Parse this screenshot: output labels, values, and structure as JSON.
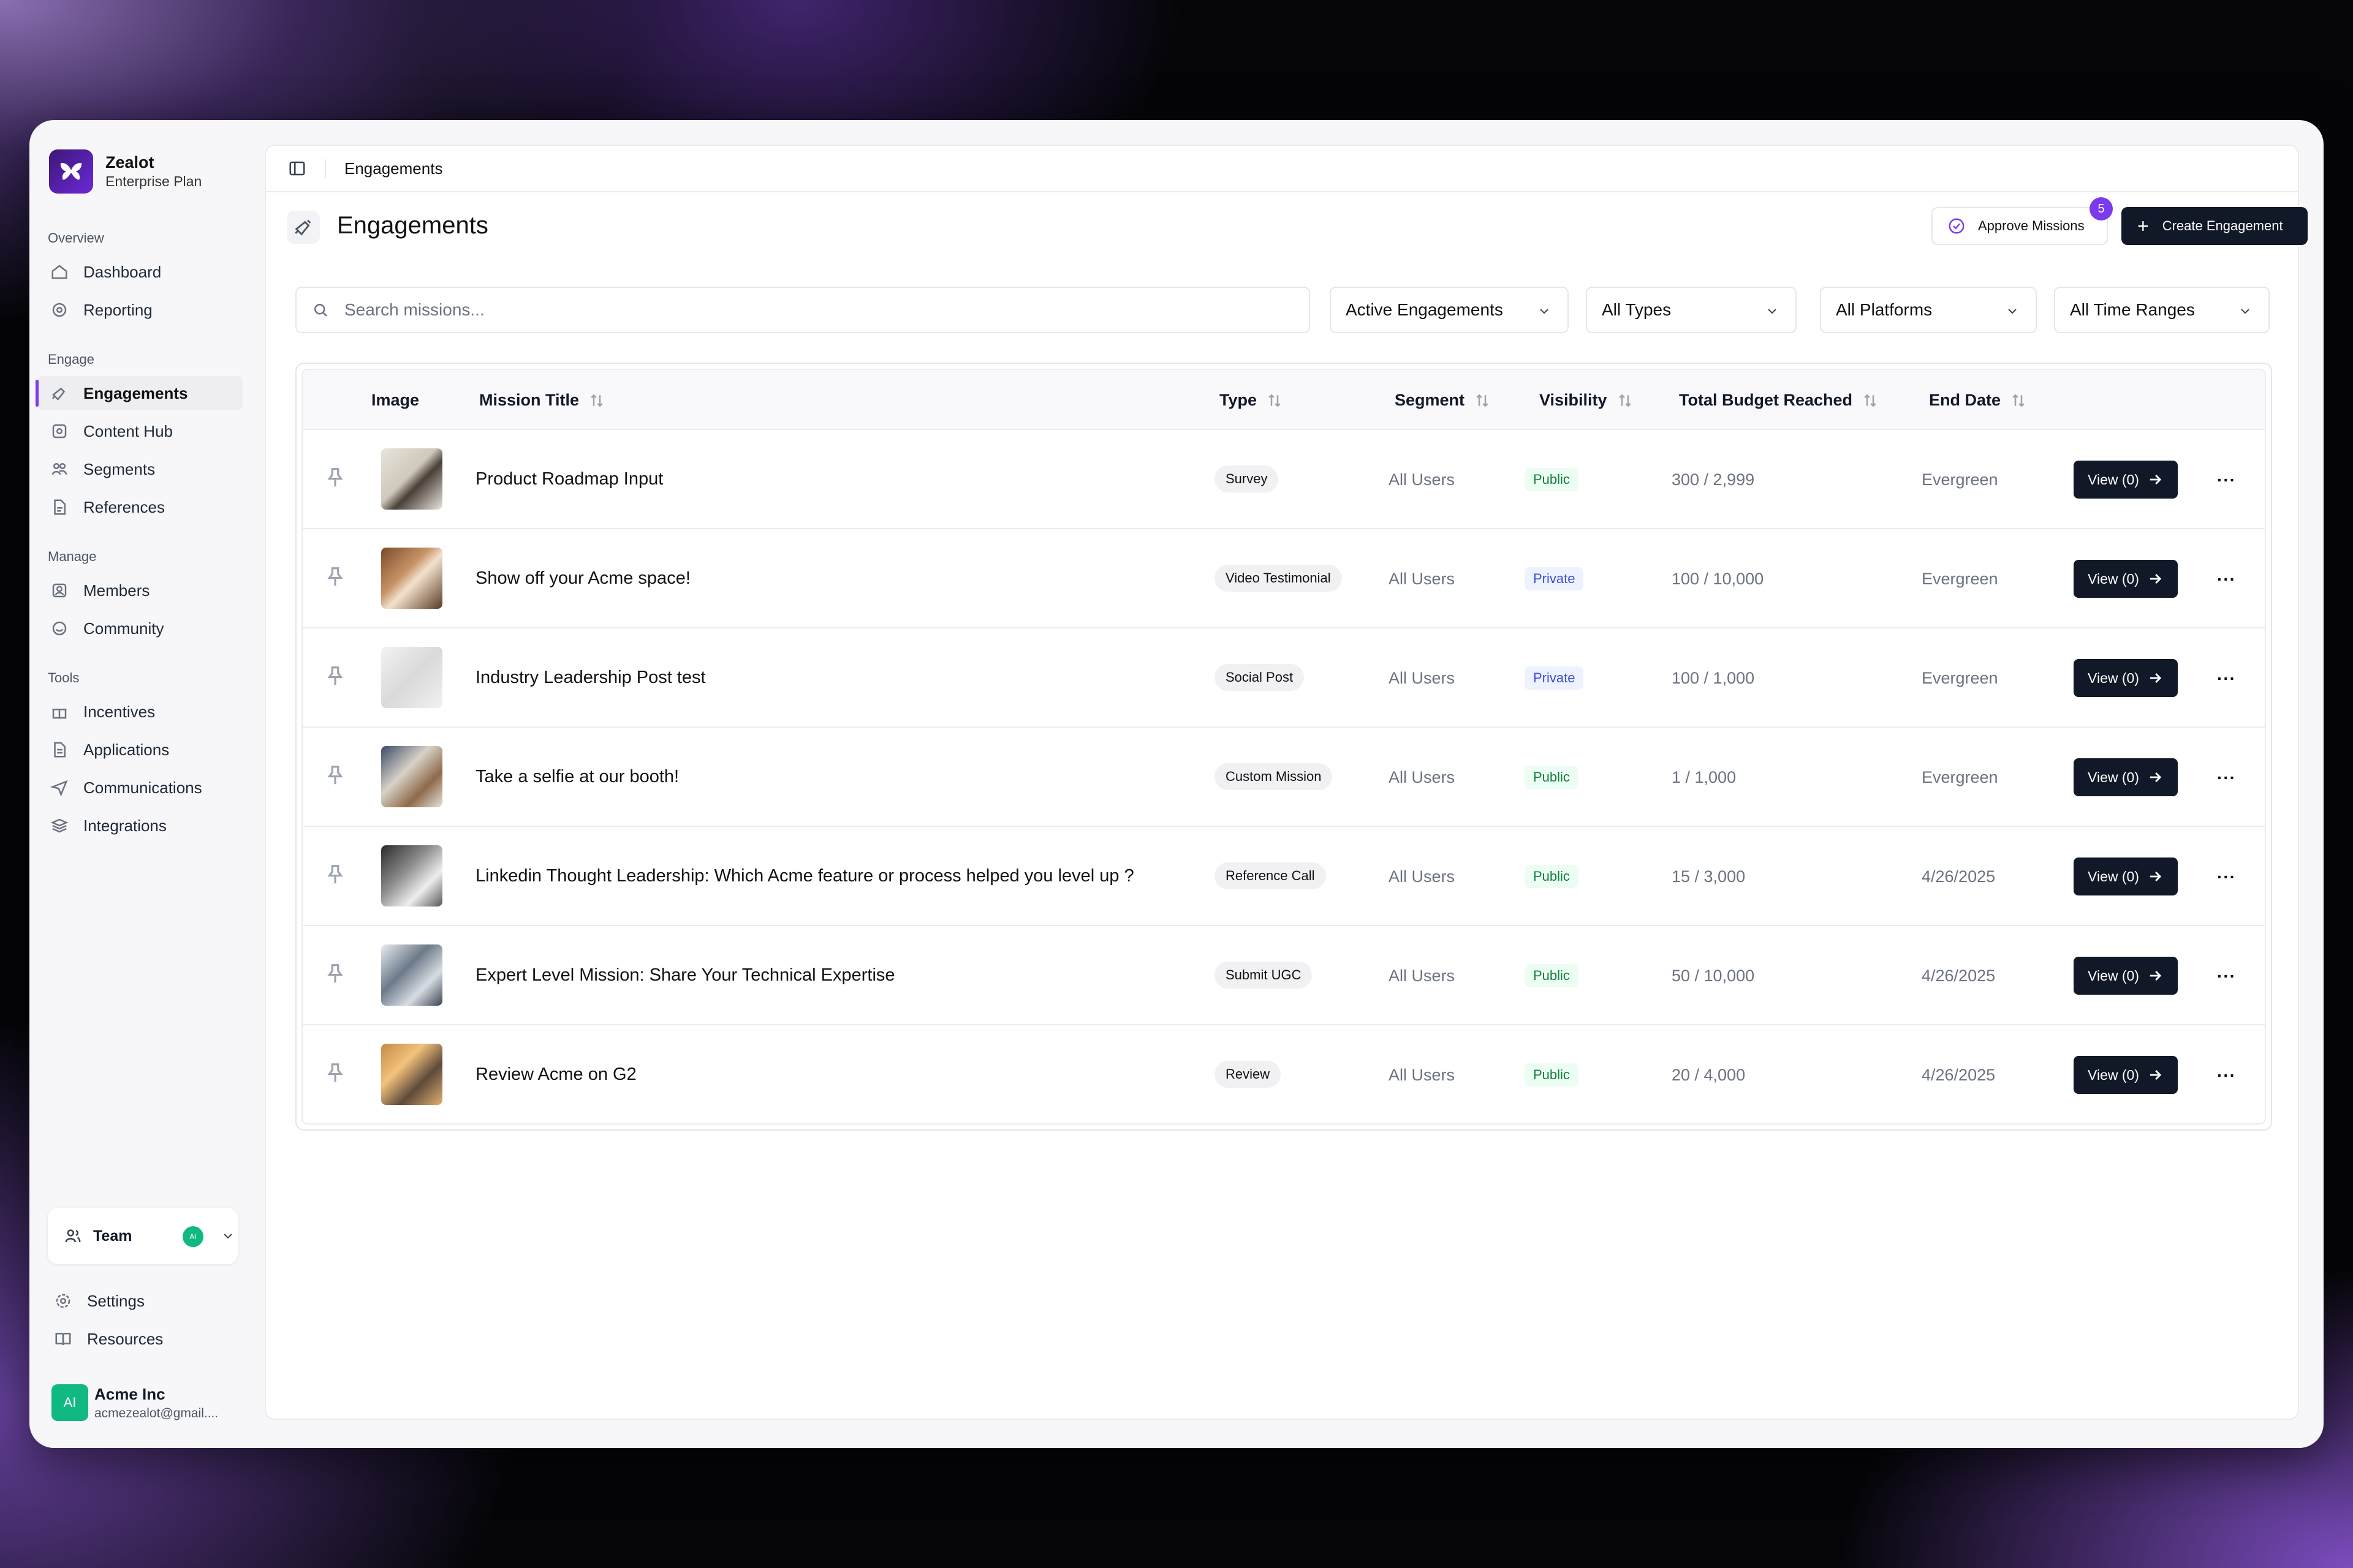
{
  "brand": {
    "name": "Zealot",
    "plan": "Enterprise Plan"
  },
  "sidebar": {
    "sections": [
      {
        "label": "Overview",
        "items": [
          {
            "label": "Dashboard",
            "icon": "home-icon"
          },
          {
            "label": "Reporting",
            "icon": "reporting-icon"
          }
        ]
      },
      {
        "label": "Engage",
        "items": [
          {
            "label": "Engagements",
            "icon": "engagements-icon",
            "active": true
          },
          {
            "label": "Content Hub",
            "icon": "content-hub-icon"
          },
          {
            "label": "Segments",
            "icon": "segments-icon"
          },
          {
            "label": "References",
            "icon": "references-icon"
          }
        ]
      },
      {
        "label": "Manage",
        "items": [
          {
            "label": "Members",
            "icon": "members-icon"
          },
          {
            "label": "Community",
            "icon": "community-icon"
          }
        ]
      },
      {
        "label": "Tools",
        "items": [
          {
            "label": "Incentives",
            "icon": "gift-icon"
          },
          {
            "label": "Applications",
            "icon": "document-icon"
          },
          {
            "label": "Communications",
            "icon": "send-icon"
          },
          {
            "label": "Integrations",
            "icon": "layers-icon"
          }
        ]
      }
    ],
    "team": {
      "label": "Team",
      "badge": "AI"
    },
    "bottom": [
      {
        "label": "Settings",
        "icon": "gear-icon"
      },
      {
        "label": "Resources",
        "icon": "book-icon"
      }
    ],
    "user": {
      "initials": "AI",
      "name": "Acme Inc",
      "email": "acmezealot@gmail...."
    }
  },
  "topbar": {
    "breadcrumb": "Engagements"
  },
  "header": {
    "title": "Engagements",
    "approve_label": "Approve Missions",
    "approve_count": "5",
    "create_label": "Create Engagement"
  },
  "filters": {
    "search_placeholder": "Search missions...",
    "status": "Active Engagements",
    "types": "All Types",
    "platforms": "All Platforms",
    "time": "All Time Ranges"
  },
  "table": {
    "columns": {
      "image": "Image",
      "title": "Mission Title",
      "type": "Type",
      "segment": "Segment",
      "visibility": "Visibility",
      "budget": "Total Budget Reached",
      "end": "End Date"
    },
    "rows": [
      {
        "title": "Product Roadmap Input",
        "type": "Survey",
        "segment": "All Users",
        "visibility": "Public",
        "budget": "300 / 2,999",
        "end": "Evergreen",
        "view": "View (0)"
      },
      {
        "title": "Show off your Acme space!",
        "type": "Video Testimonial",
        "segment": "All Users",
        "visibility": "Private",
        "budget": "100 / 10,000",
        "end": "Evergreen",
        "view": "View (0)"
      },
      {
        "title": "Industry Leadership Post test",
        "type": "Social Post",
        "segment": "All Users",
        "visibility": "Private",
        "budget": "100 / 1,000",
        "end": "Evergreen",
        "view": "View (0)"
      },
      {
        "title": "Take a selfie at our booth!",
        "type": "Custom Mission",
        "segment": "All Users",
        "visibility": "Public",
        "budget": "1 / 1,000",
        "end": "Evergreen",
        "view": "View (0)"
      },
      {
        "title": "Linkedin Thought Leadership: Which Acme feature or process helped you level up ?",
        "type": "Reference Call",
        "segment": "All Users",
        "visibility": "Public",
        "budget": "15 / 3,000",
        "end": "4/26/2025",
        "view": "View (0)"
      },
      {
        "title": "Expert Level Mission: Share Your Technical Expertise",
        "type": "Submit UGC",
        "segment": "All Users",
        "visibility": "Public",
        "budget": "50 / 10,000",
        "end": "4/26/2025",
        "view": "View (0)"
      },
      {
        "title": "Review Acme on G2",
        "type": "Review",
        "segment": "All Users",
        "visibility": "Public",
        "budget": "20 / 4,000",
        "end": "4/26/2025",
        "view": "View (0)"
      }
    ]
  },
  "colors": {
    "accent": "#7c3aed",
    "dark_button": "#111827",
    "public": "#15803d",
    "private": "#3b4fd8"
  }
}
